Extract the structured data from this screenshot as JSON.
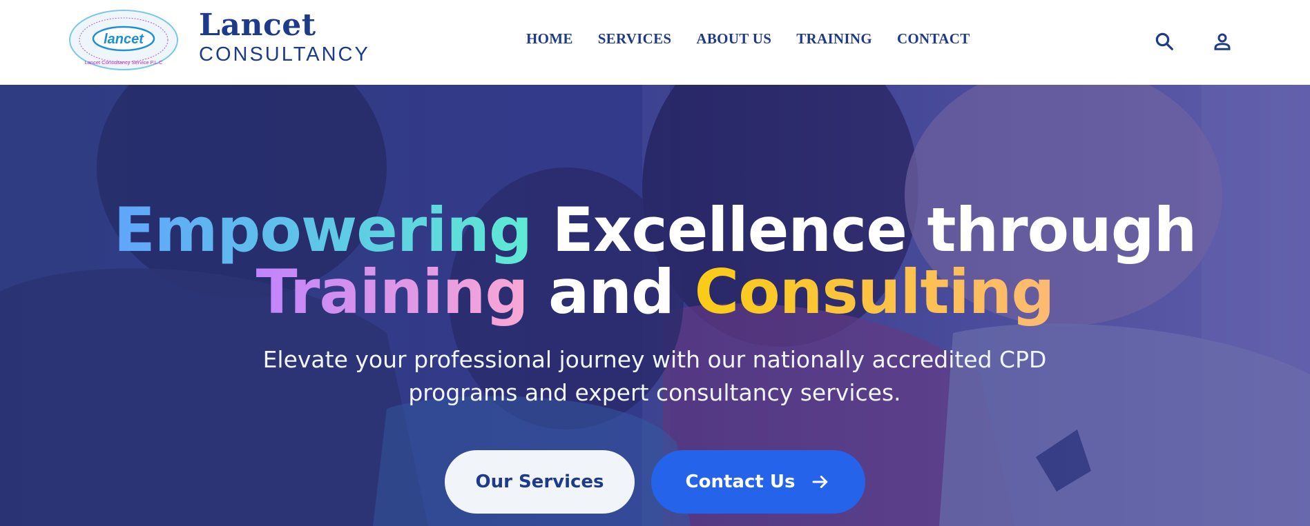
{
  "header": {
    "logo": {
      "badge_text": "lancet",
      "ring_text": "Lancet Consultancy Service P.L.C"
    },
    "brand_name": "Lancet",
    "brand_sub": "CONSULTANCY",
    "nav": [
      "HOME",
      "SERVICES",
      "ABOUT US",
      "TRAINING",
      "CONTACT"
    ],
    "icons": {
      "search": "search-icon",
      "account": "user-icon"
    }
  },
  "hero": {
    "title_line1": {
      "highlight": "Empowering",
      "rest": "Excellence through"
    },
    "title_line2": {
      "highlight1": "Training",
      "middle": "and",
      "highlight2": "Consulting"
    },
    "subtitle_line1": "Elevate your professional journey with our nationally accredited CPD",
    "subtitle_line2": "programs and expert consultancy services.",
    "buttons": {
      "services_label": "Our Services",
      "contact_label": "Contact Us",
      "contact_icon": "arrow-right-icon"
    }
  },
  "colors": {
    "brand_navy": "#1e3a8a",
    "primary_blue": "#2563eb",
    "light_button": "#f1f5f9",
    "gradient_blue": [
      "#60a5fa",
      "#5eead4"
    ],
    "gradient_pink": [
      "#c084fc",
      "#f9a8d4"
    ],
    "gradient_gold": [
      "#facc15",
      "#fdba74"
    ]
  }
}
